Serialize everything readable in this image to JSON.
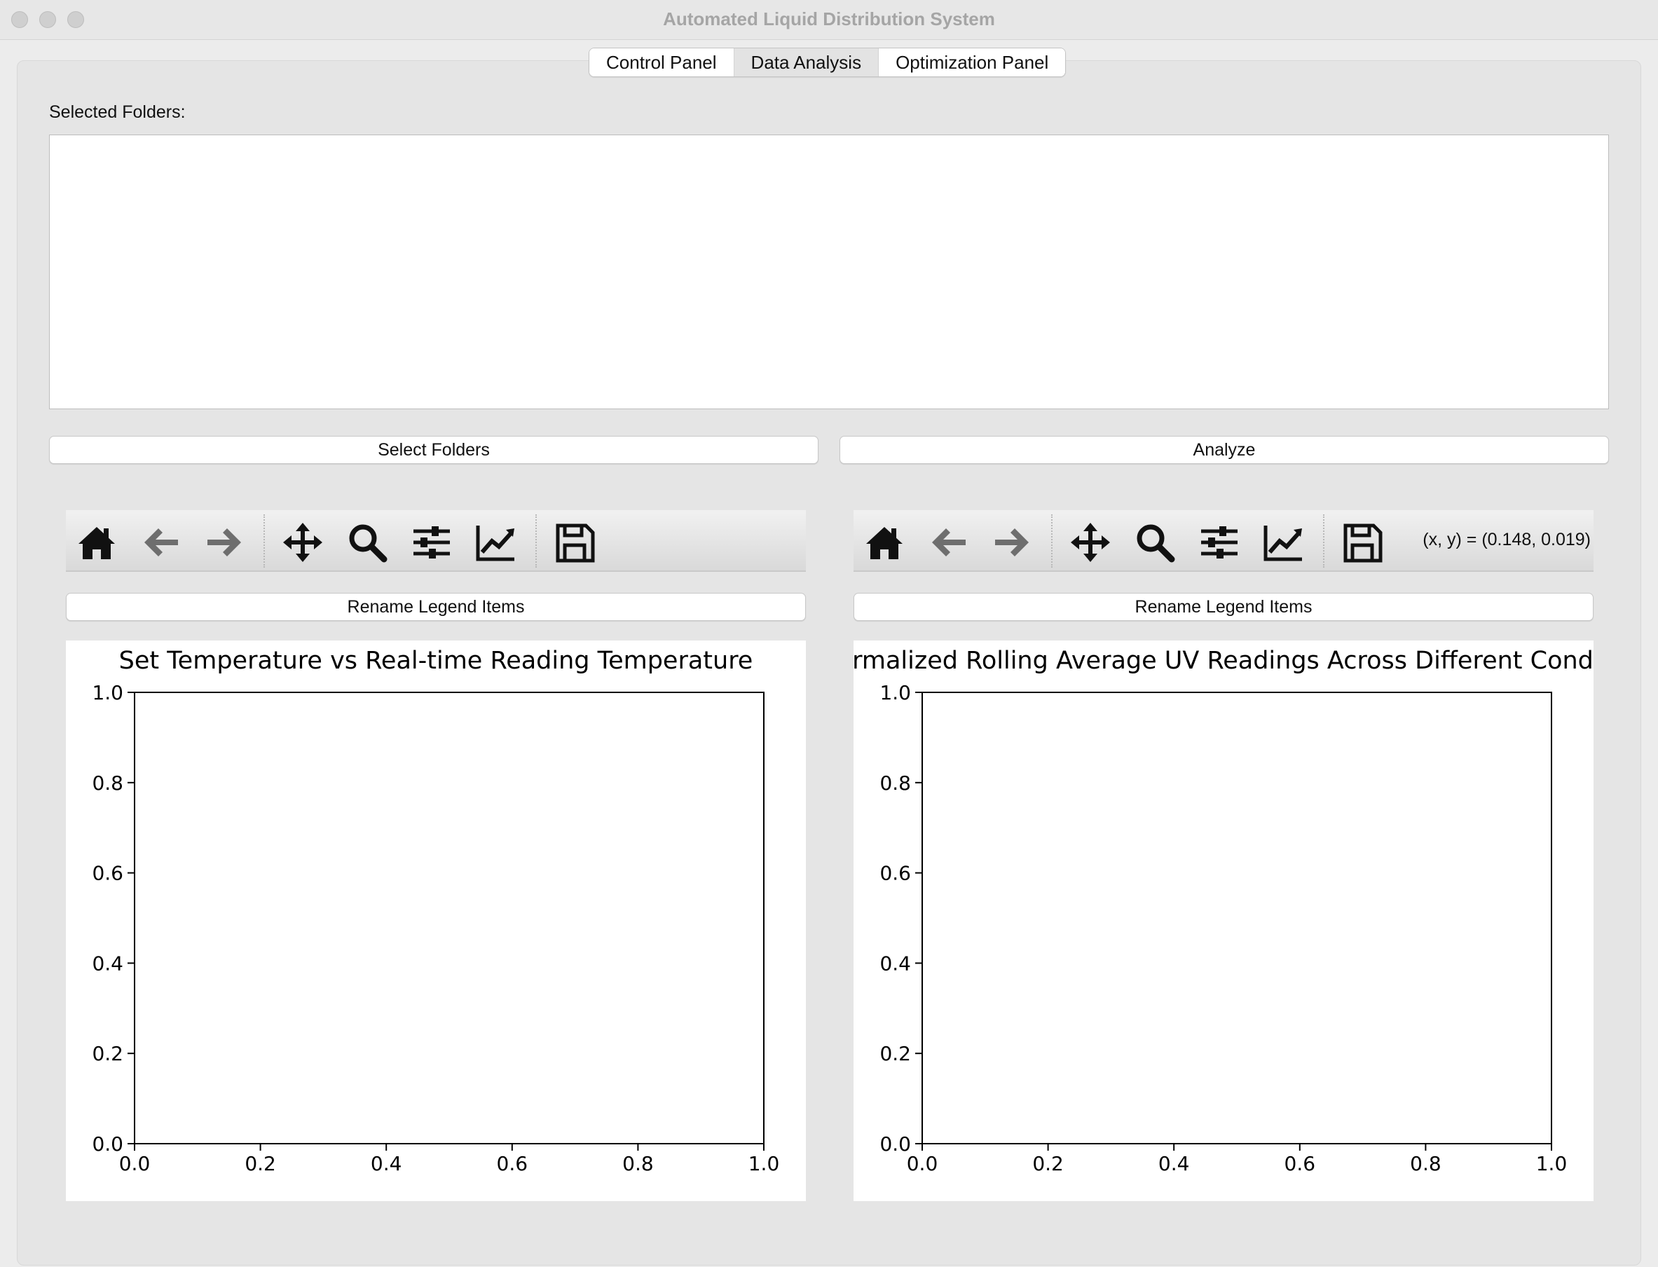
{
  "window": {
    "title": "Automated Liquid Distribution System"
  },
  "tabs": [
    {
      "label": "Control Panel",
      "active": false
    },
    {
      "label": "Data Analysis",
      "active": true
    },
    {
      "label": "Optimization Panel",
      "active": false
    }
  ],
  "folders": {
    "label": "Selected Folders:",
    "items": []
  },
  "buttons": {
    "select_folders": "Select Folders",
    "analyze": "Analyze"
  },
  "toolbar_icons": [
    "home-icon",
    "back-arrow-icon",
    "forward-arrow-icon",
    "pan-move-icon",
    "zoom-magnifier-icon",
    "configure-subplots-icon",
    "edit-axis-icon",
    "save-floppy-icon"
  ],
  "left_plot": {
    "rename_button": "Rename Legend Items",
    "coords": ""
  },
  "right_plot": {
    "rename_button": "Rename Legend Items",
    "coords": "(x, y) = (0.148, 0.019)"
  },
  "chart_data": [
    {
      "type": "line",
      "title": "Set Temperature vs Real-time Reading Temperature",
      "xlabel": "",
      "ylabel": "",
      "xlim": [
        0,
        1
      ],
      "ylim": [
        0,
        1
      ],
      "xticks": [
        "0.0",
        "0.2",
        "0.4",
        "0.6",
        "0.8",
        "1.0"
      ],
      "yticks": [
        "0.0",
        "0.2",
        "0.4",
        "0.6",
        "0.8",
        "1.0"
      ],
      "series": []
    },
    {
      "type": "line",
      "title": "ormalized Rolling Average UV Readings Across Different Condit",
      "xlabel": "",
      "ylabel": "",
      "xlim": [
        0,
        1
      ],
      "ylim": [
        0,
        1
      ],
      "xticks": [
        "0.0",
        "0.2",
        "0.4",
        "0.6",
        "0.8",
        "1.0"
      ],
      "yticks": [
        "0.0",
        "0.2",
        "0.4",
        "0.6",
        "0.8",
        "1.0"
      ],
      "series": []
    }
  ]
}
